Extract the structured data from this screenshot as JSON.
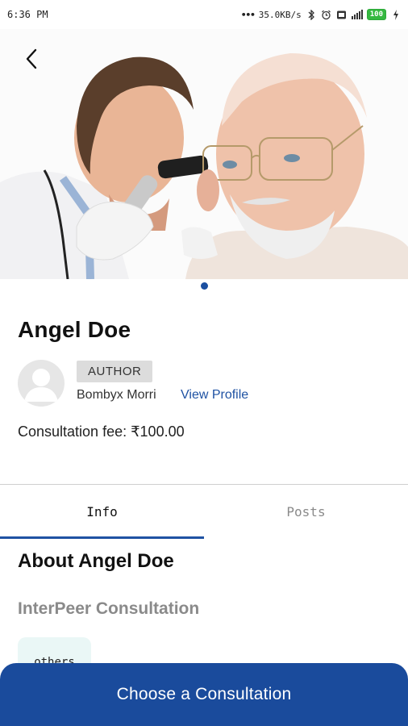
{
  "status_bar": {
    "time": "6:36 PM",
    "network_speed": "35.0KB/s",
    "battery": "100",
    "icons": [
      "dots-icon",
      "bluetooth-icon",
      "alarm-icon",
      "sim-icon",
      "signal-icon",
      "battery-icon",
      "charging-icon"
    ]
  },
  "header": {
    "back_icon": "chevron-left-icon"
  },
  "hero": {
    "image_description_icon": "doctor-ear-exam-photo",
    "carousel_index": 1,
    "carousel_count": 1
  },
  "doctor": {
    "name": "Angel Doe",
    "role_badge": "AUTHOR",
    "author_name": "Bombyx Morri",
    "view_profile_label": "View Profile",
    "fee_text": "Consultation fee: ₹100.00"
  },
  "tabs": [
    {
      "label": "Info",
      "active": true
    },
    {
      "label": "Posts",
      "active": false
    }
  ],
  "info": {
    "about_heading": "About Angel Doe",
    "consultation_type": "InterPeer Consultation",
    "chip_label": "others"
  },
  "cta": {
    "label": "Choose a Consultation"
  },
  "colors": {
    "accent": "#1a4b9c",
    "link": "#1f52a3",
    "badge_bg": "#dcdcdc",
    "chip_bg": "#eaf7f6",
    "battery": "#35b840"
  }
}
